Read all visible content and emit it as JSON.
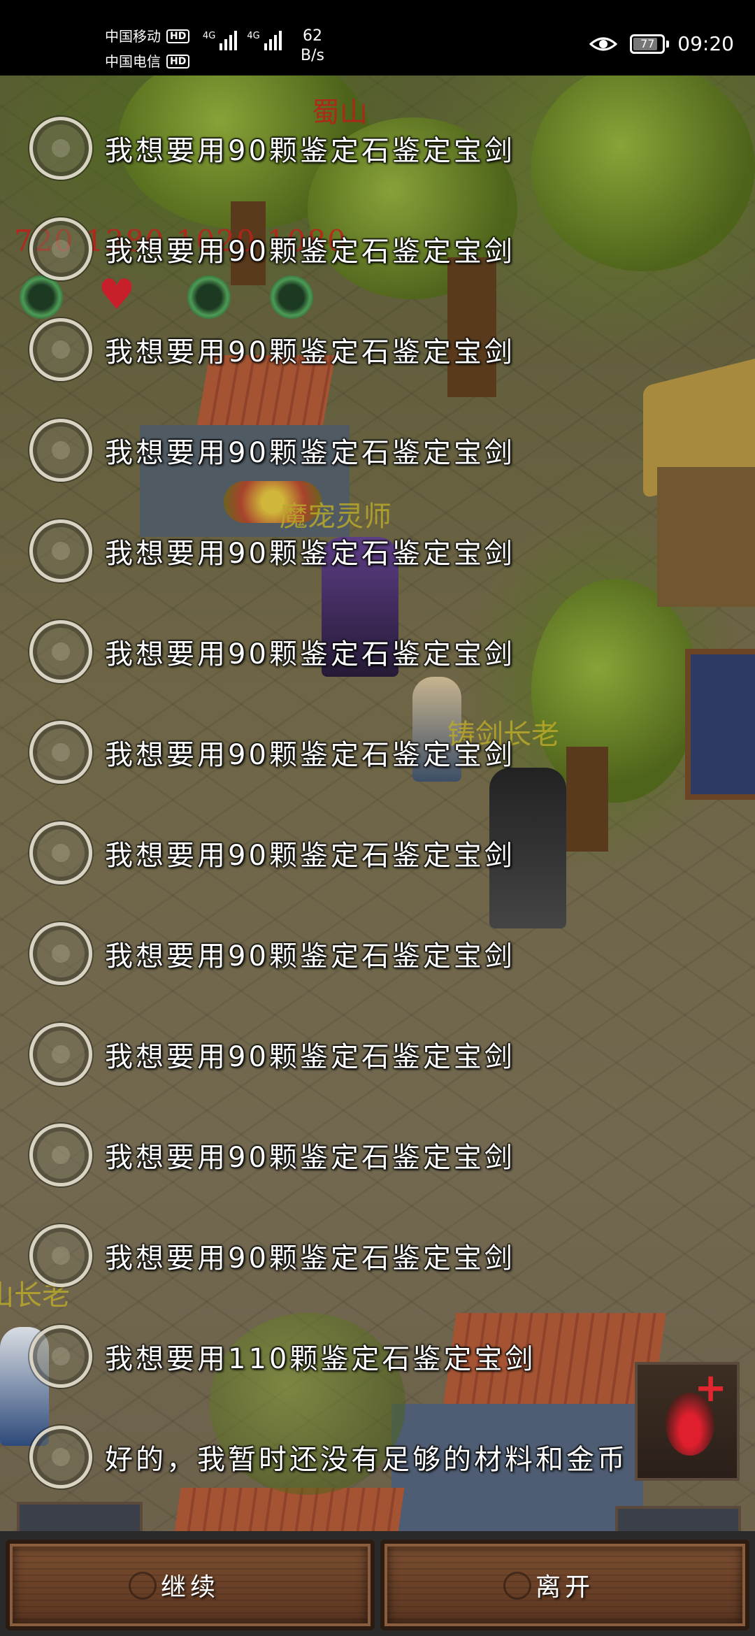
{
  "status_bar": {
    "carrier_1": "中国移动",
    "carrier_2": "中国电信",
    "hd_badge": "HD",
    "net_type_1": "4G",
    "net_type_2": "4G",
    "net_speed_value": "62",
    "net_speed_unit": "B/s",
    "battery_level": "77",
    "time": "09:20"
  },
  "scene": {
    "location_label": "蜀山",
    "npc_pet_master": "魔宠灵师",
    "npc_sword_elder": "铸剑长老",
    "npc_partial_elder": "山长老",
    "stat_numbers": "720 1380 1020 1080"
  },
  "dialog_options": [
    "我想要用90颗鉴定石鉴定宝剑",
    "我想要用90颗鉴定石鉴定宝剑",
    "我想要用90颗鉴定石鉴定宝剑",
    "我想要用90颗鉴定石鉴定宝剑",
    "我想要用90颗鉴定石鉴定宝剑",
    "我想要用90颗鉴定石鉴定宝剑",
    "我想要用90颗鉴定石鉴定宝剑",
    "我想要用90颗鉴定石鉴定宝剑",
    "我想要用90颗鉴定石鉴定宝剑",
    "我想要用90颗鉴定石鉴定宝剑",
    "我想要用90颗鉴定石鉴定宝剑",
    "我想要用90颗鉴定石鉴定宝剑",
    "我想要用110颗鉴定石鉴定宝剑",
    "好的，我暂时还没有足够的材料和金币"
  ],
  "buttons": {
    "continue": "继续",
    "leave": "离开"
  },
  "colors": {
    "npc_label_yellow": "#b9a92a",
    "location_red": "#b8201a",
    "accent_red": "#e01f2e"
  },
  "icons": {
    "buff_icon": "green-monk-icon",
    "health_icon": "heart-icon",
    "skill_icon": "red-figure-plus-icon"
  }
}
